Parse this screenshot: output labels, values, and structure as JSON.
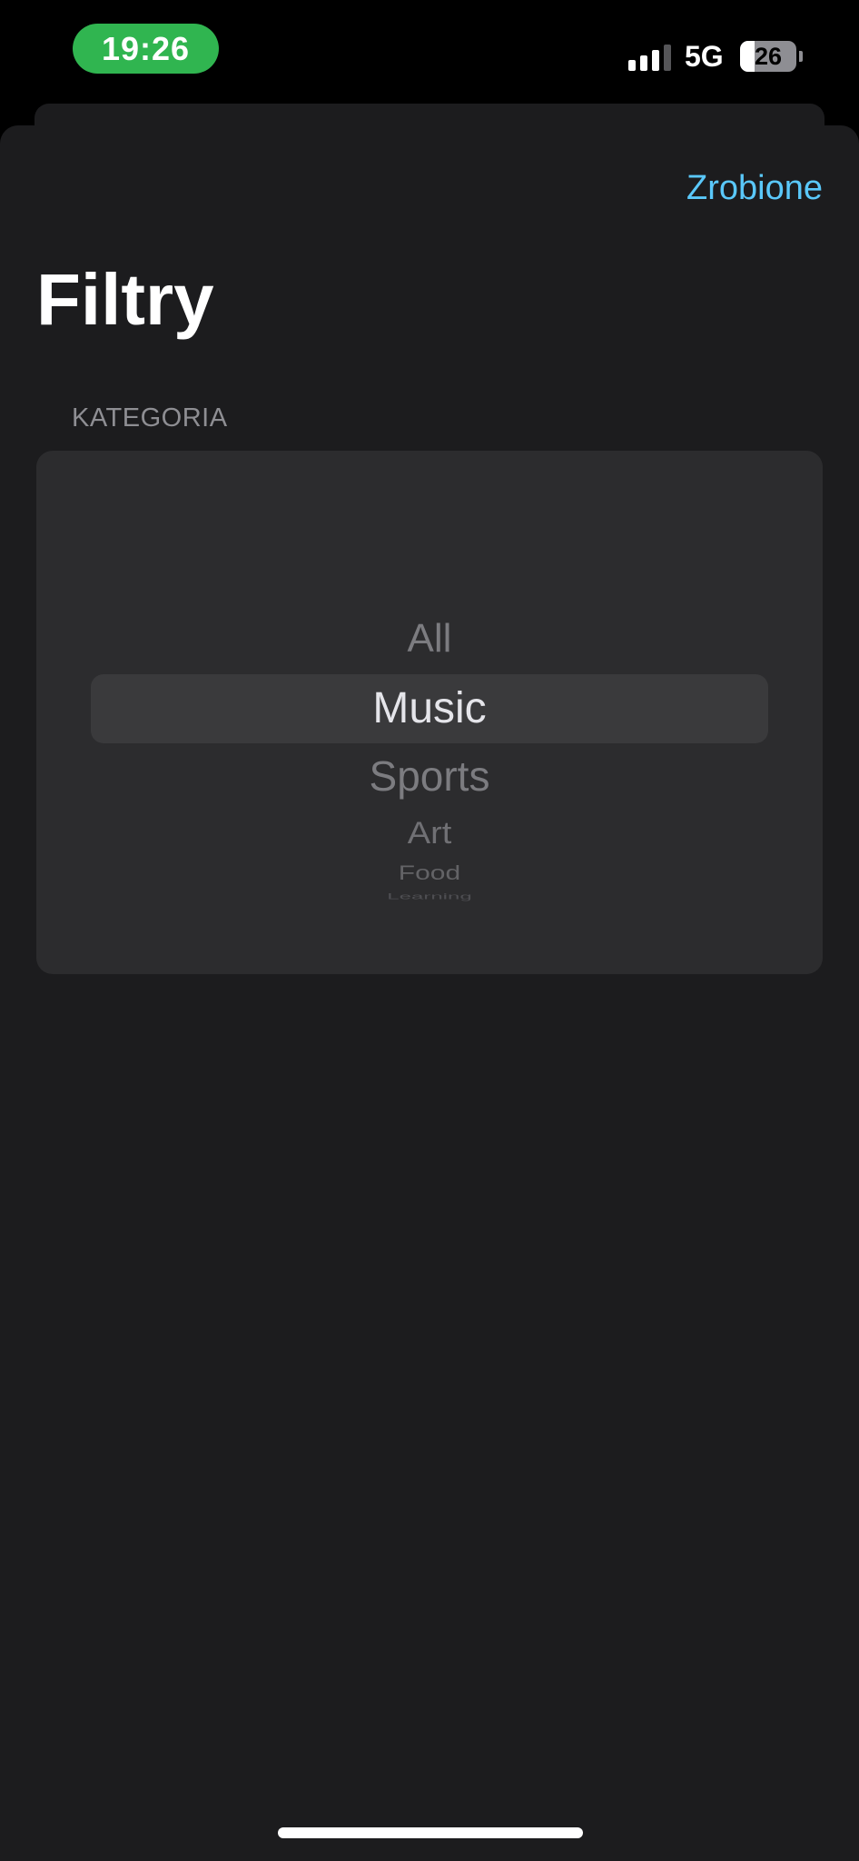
{
  "status_bar": {
    "time": "19:26",
    "network": "5G",
    "battery_level": "26",
    "signal_bars_filled": 3,
    "signal_bars_total": 4,
    "time_pill_color": "#30b550"
  },
  "header": {
    "done_label": "Zrobione",
    "title": "Filtry",
    "accent_color": "#5ac8fa"
  },
  "category": {
    "section_label": "KATEGORIA",
    "options": [
      "All",
      "Music",
      "Sports",
      "Art",
      "Food",
      "Learning"
    ],
    "selected": "Music"
  }
}
